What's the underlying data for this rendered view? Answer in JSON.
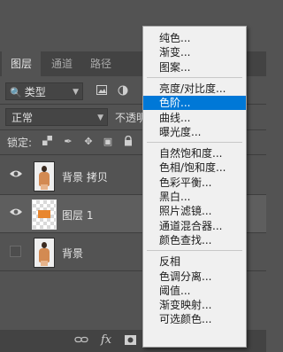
{
  "panel": {
    "tabs": [
      {
        "label": "图层",
        "active": true
      },
      {
        "label": "通道",
        "active": false
      },
      {
        "label": "路径",
        "active": false
      }
    ],
    "filter": {
      "label": "类型"
    },
    "blend_mode": {
      "value": "正常"
    },
    "opacity_label": "不透明",
    "lock_label": "锁定:",
    "layers": [
      {
        "name": "背景 拷贝",
        "visible": true
      },
      {
        "name": "图层 1",
        "visible": true,
        "selected": true
      },
      {
        "name": "背景",
        "visible": false
      }
    ],
    "bottom_icons": [
      "link-icon",
      "fx-icon",
      "mask-icon"
    ],
    "fx_label": "fx"
  },
  "menu": {
    "groups": [
      [
        "纯色...",
        "渐变...",
        "图案..."
      ],
      [
        "亮度/对比度...",
        "色阶...",
        "曲线...",
        "曝光度..."
      ],
      [
        "自然饱和度...",
        "色相/饱和度...",
        "色彩平衡...",
        "黑白...",
        "照片滤镜...",
        "通道混合器...",
        "颜色查找..."
      ],
      [
        "反相",
        "色调分离...",
        "阈值...",
        "渐变映射...",
        "可选颜色..."
      ]
    ],
    "highlighted": "色阶..."
  },
  "colors": {
    "panel_bg": "#535353",
    "menu_bg": "#f0f0f0",
    "highlight": "#0078d7",
    "accent_orange": "#e8862e"
  }
}
